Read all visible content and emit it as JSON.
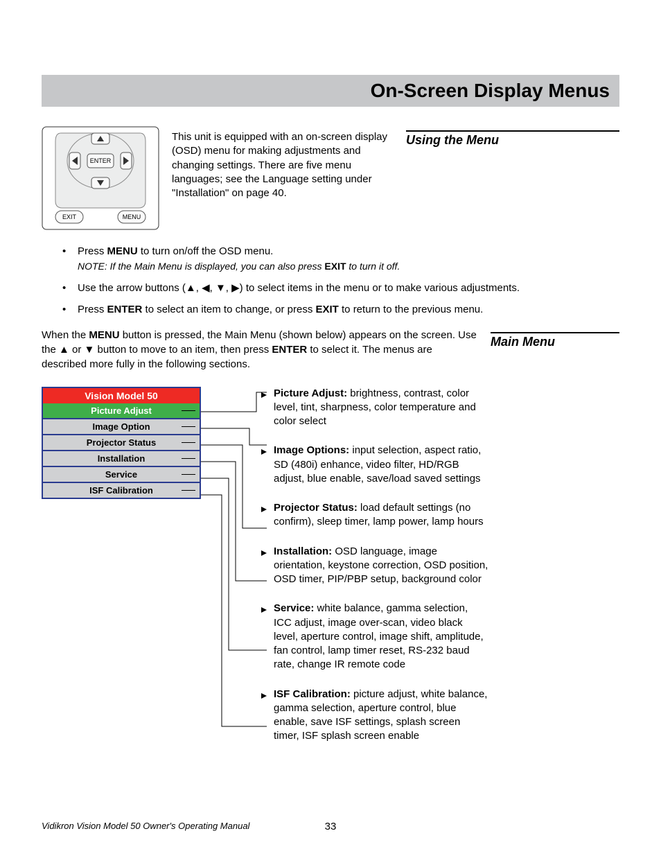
{
  "title": "On-Screen Display Menus",
  "heading_using": "Using the Menu",
  "heading_main": "Main Menu",
  "intro": "This unit is equipped with an on-screen display (OSD) menu for making adjustments and changing settings. There are five menu languages; see the Language setting under \"Installation\" on page 40.",
  "bullet1_pre": "Press ",
  "bullet1_bold": "MENU",
  "bullet1_post": " to turn on/off the OSD menu.",
  "note_pre": "NOTE: If the Main Menu is displayed, you can also press ",
  "note_bold": "EXIT",
  "note_post": " to turn it off.",
  "bullet2": "Use the arrow buttons (▲, ◀, ▼, ▶) to select items in the menu or to make various adjustments.",
  "bullet3_pre": "Press ",
  "bullet3_b1": "ENTER",
  "bullet3_mid": " to select an item to change, or press ",
  "bullet3_b2": "EXIT",
  "bullet3_post": " to return to the previous menu.",
  "mainmenu_p1": "When the ",
  "mainmenu_b1": "MENU",
  "mainmenu_p2": " button is pressed, the Main Menu (shown below) appears on the screen. Use the ▲ or ▼ button to move to an item, then press ",
  "mainmenu_b2": "ENTER",
  "mainmenu_p3": " to select it. The menus are described more fully in the following sections.",
  "menu_title": "Vision Model 50",
  "menu_items": [
    "Picture Adjust",
    "Image Option",
    "Projector Status",
    "Installation",
    "Service",
    "ISF Calibration"
  ],
  "desc": [
    {
      "label": "Picture Adjust:",
      "text": " brightness, contrast, color level, tint, sharpness, color temperature and color select"
    },
    {
      "label": "Image Options:",
      "text": " input selection, aspect ratio, SD (480i) enhance, video filter, HD/RGB adjust, blue enable, save/load saved settings"
    },
    {
      "label": "Projector Status:",
      "text": " load default settings (no confirm), sleep timer, lamp power, lamp hours"
    },
    {
      "label": "Installation:",
      "text": " OSD language, image orientation, keystone correction, OSD position, OSD timer, PIP/PBP setup, background color"
    },
    {
      "label": "Service:",
      "text": " white balance, gamma selection, ICC adjust, image over-scan, video black level, aperture control, image shift, amplitude, fan control, lamp timer reset, RS-232 baud rate, change IR remote code"
    },
    {
      "label": "ISF Calibration:",
      "text": " picture adjust, white balance, gamma selection, aperture control, blue enable, save ISF settings, splash screen timer, ISF splash screen enable"
    }
  ],
  "remote": {
    "enter": "ENTER",
    "exit": "EXIT",
    "menu": "MENU"
  },
  "footer": "Vidikron Vision Model 50 Owner's Operating Manual",
  "page_number": "33"
}
